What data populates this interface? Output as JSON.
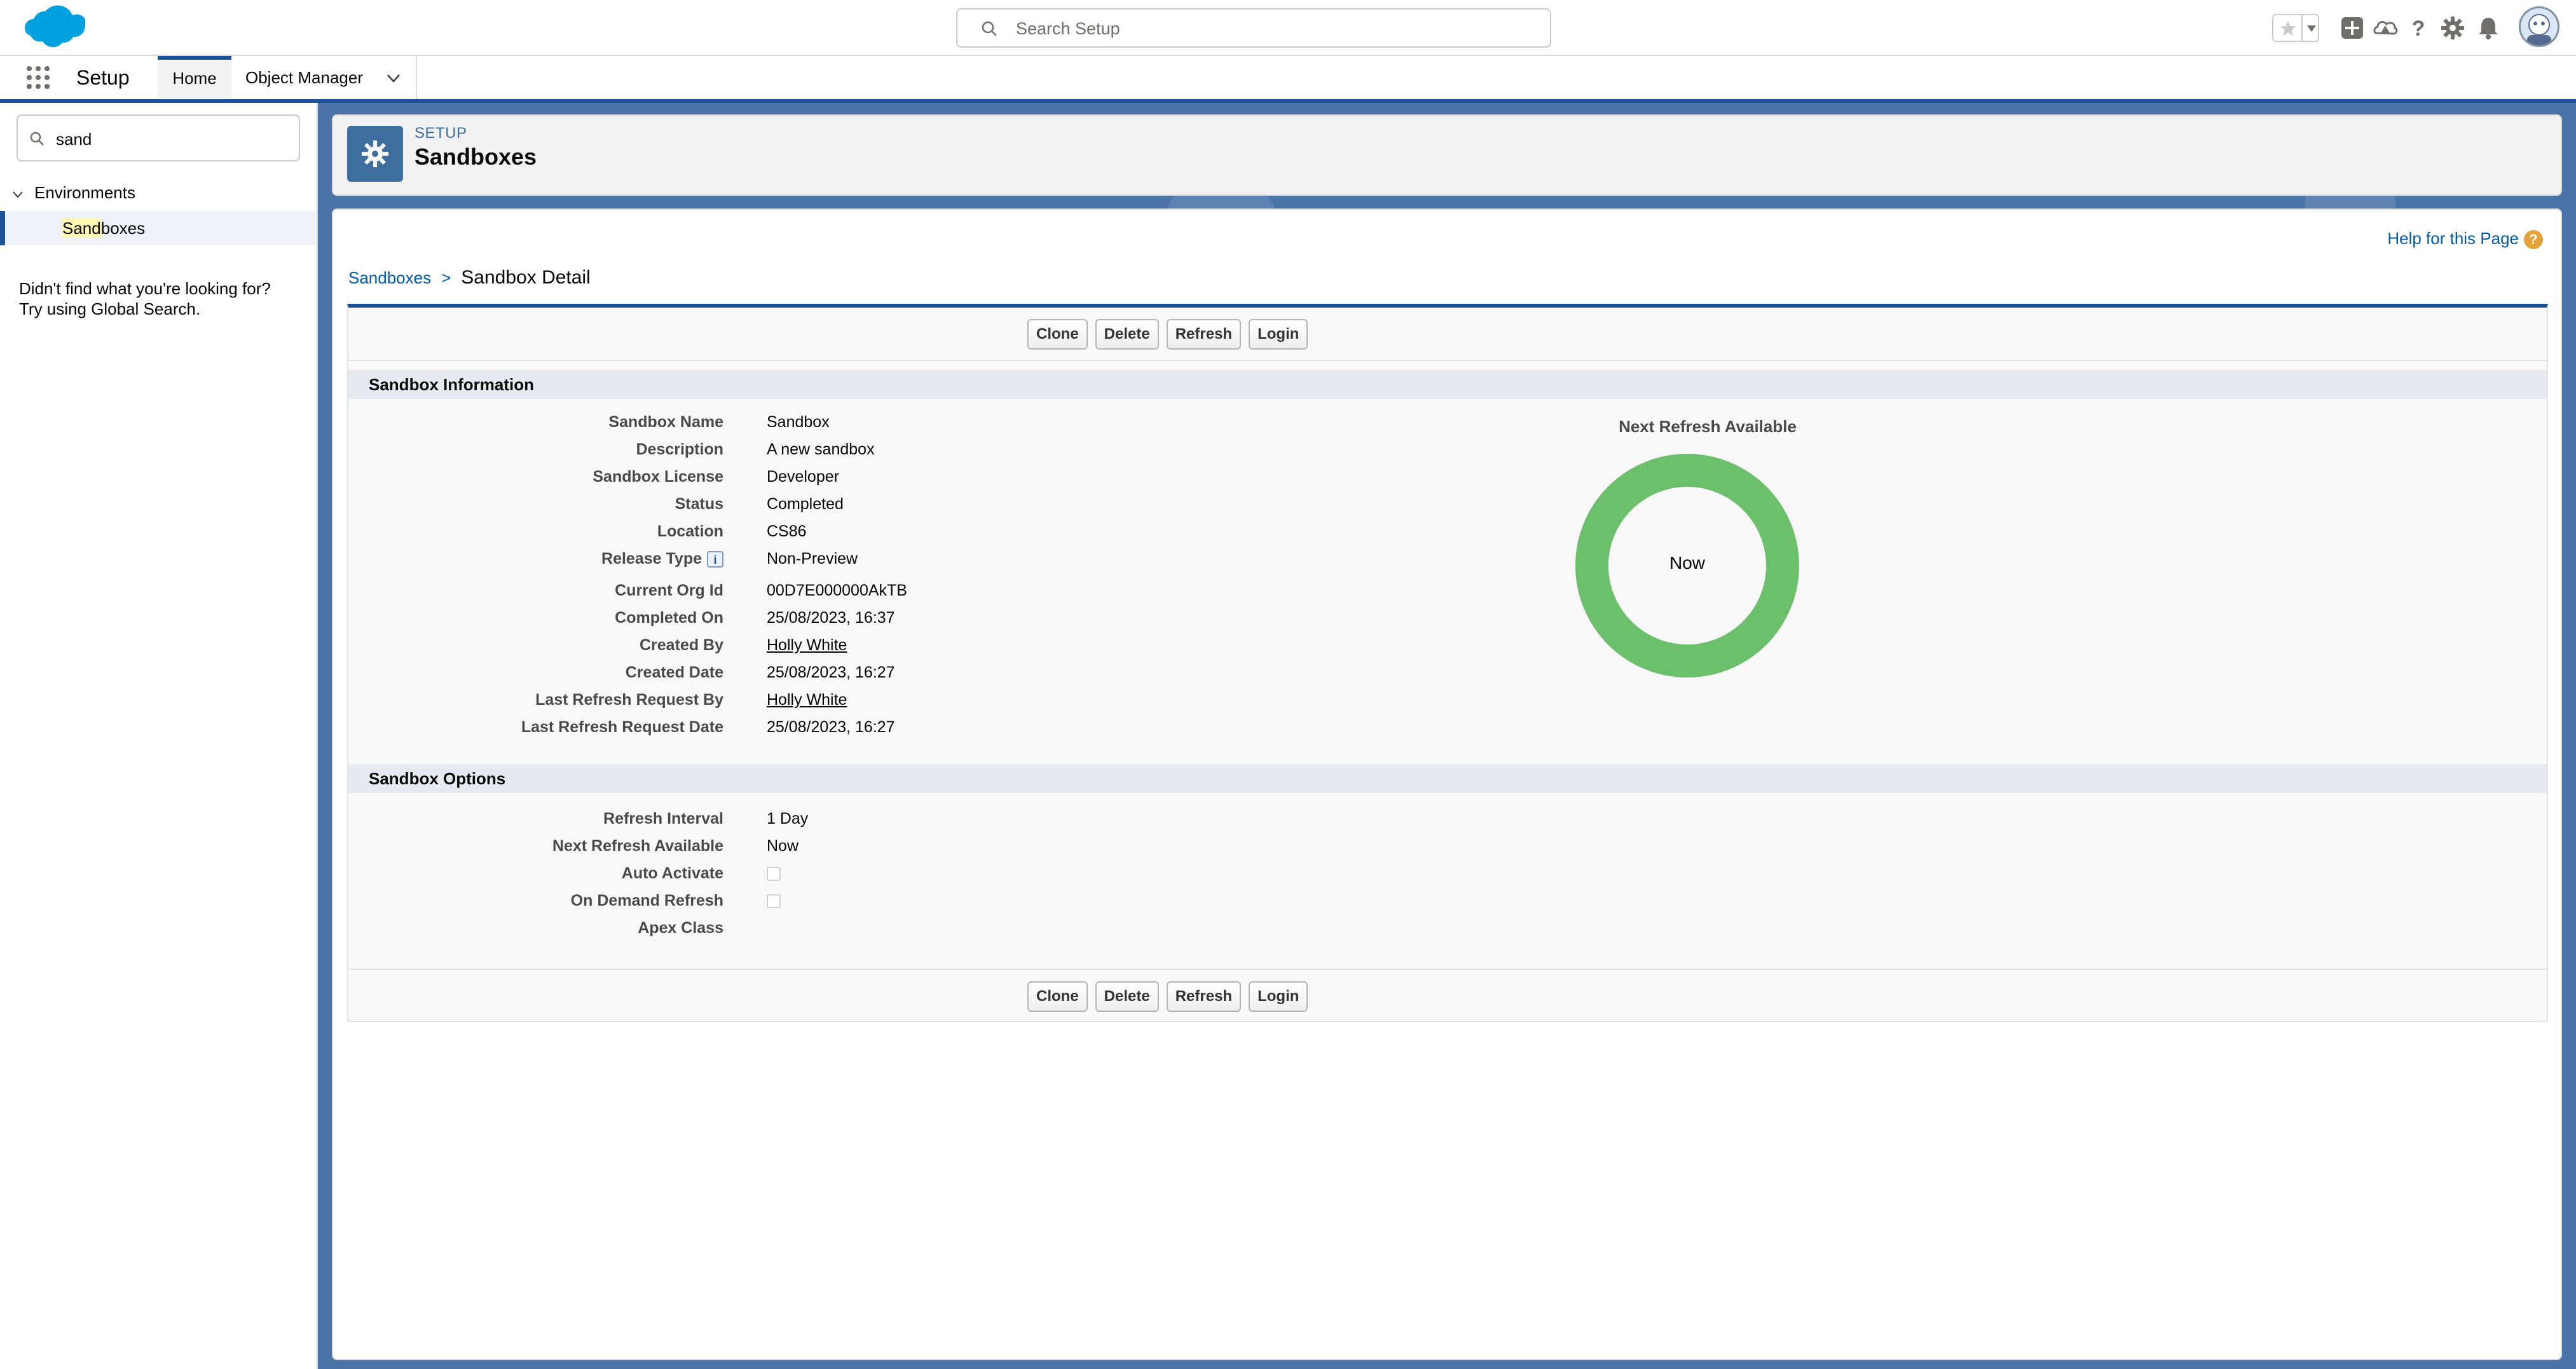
{
  "header": {
    "search_placeholder": "Search Setup",
    "brand_color": "#00a1e0"
  },
  "context": {
    "app_name": "Setup",
    "tabs": [
      {
        "label": "Home"
      },
      {
        "label": "Object Manager"
      }
    ]
  },
  "sidebar": {
    "search_value": "sand",
    "group_label": "Environments",
    "item_label_match": "Sand",
    "item_label_rest": "boxes",
    "not_found_line1": "Didn't find what you're looking for?",
    "not_found_line2": "Try using Global Search."
  },
  "page_header": {
    "eyebrow": "SETUP",
    "title": "Sandboxes"
  },
  "content": {
    "help_link": "Help for this Page",
    "help_icon": "?",
    "breadcrumb_parent": "Sandboxes",
    "breadcrumb_sep": ">",
    "breadcrumb_current": "Sandbox Detail",
    "buttons": [
      "Clone",
      "Delete",
      "Refresh",
      "Login"
    ],
    "section_info": "Sandbox Information",
    "section_options": "Sandbox Options",
    "info_fields": [
      {
        "label": "Sandbox Name",
        "value": "Sandbox"
      },
      {
        "label": "Description",
        "value": "A new sandbox"
      },
      {
        "label": "Sandbox License",
        "value": "Developer"
      },
      {
        "label": "Status",
        "value": "Completed"
      },
      {
        "label": "Location",
        "value": "CS86"
      },
      {
        "label": "Release Type",
        "value": "Non-Preview"
      },
      {
        "label": "Current Org Id",
        "value": "00D7E000000AkTB"
      },
      {
        "label": "Completed On",
        "value": "25/08/2023, 16:37"
      },
      {
        "label": "Created By",
        "value": "Holly White"
      },
      {
        "label": "Created Date",
        "value": "25/08/2023, 16:27"
      },
      {
        "label": "Last Refresh Request By",
        "value": "Holly White"
      },
      {
        "label": "Last Refresh Request Date",
        "value": "25/08/2023, 16:27"
      }
    ],
    "option_fields": [
      {
        "label": "Refresh Interval",
        "value": "1 Day"
      },
      {
        "label": "Next Refresh Available",
        "value": "Now"
      },
      {
        "label": "Auto Activate",
        "checked": false
      },
      {
        "label": "On Demand Refresh",
        "checked": false
      },
      {
        "label": "Apex Class",
        "value": ""
      }
    ],
    "donut": {
      "title": "Next Refresh Available",
      "center_label": "Now",
      "progress_fraction": 1.0,
      "color": "#6cbf6b"
    }
  }
}
